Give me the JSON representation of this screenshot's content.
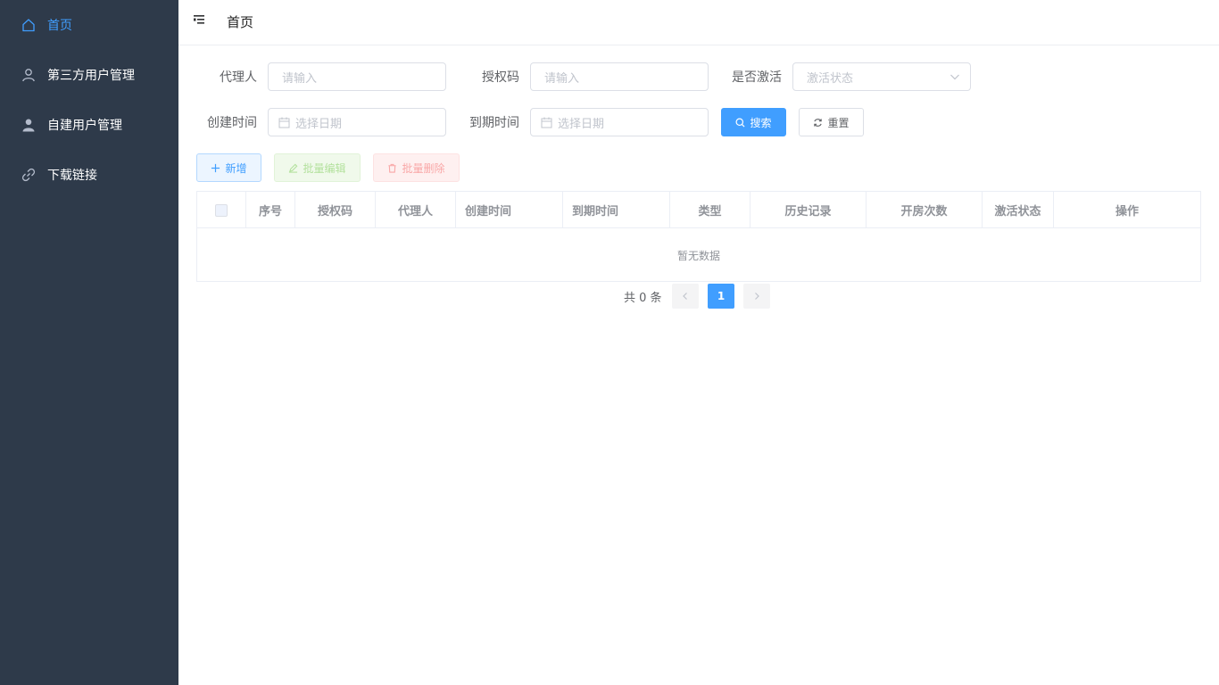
{
  "sidebar": {
    "items": [
      {
        "label": "首页",
        "icon": "home-icon",
        "active": true
      },
      {
        "label": "第三方用户管理",
        "icon": "user-outline-icon"
      },
      {
        "label": "自建用户管理",
        "icon": "user-solid-icon"
      },
      {
        "label": "下载链接",
        "icon": "link-icon"
      }
    ]
  },
  "header": {
    "breadcrumb": "首页",
    "menu_icon": "hamburger-icon"
  },
  "filters": {
    "agent": {
      "label": "代理人",
      "placeholder": "请输入",
      "value": ""
    },
    "auth_code": {
      "label": "授权码",
      "placeholder": "请输入",
      "value": ""
    },
    "activated": {
      "label": "是否激活",
      "placeholder": "激活状态",
      "value": ""
    },
    "created": {
      "label": "创建时间",
      "placeholder": "选择日期",
      "value": ""
    },
    "expire": {
      "label": "到期时间",
      "placeholder": "选择日期",
      "value": ""
    }
  },
  "actions": {
    "search": "搜索",
    "reset": "重置",
    "add": "新增",
    "batch_edit": "批量编辑",
    "batch_delete": "批量删除"
  },
  "table": {
    "columns": [
      "序号",
      "授权码",
      "代理人",
      "创建时间",
      "到期时间",
      "类型",
      "历史记录",
      "开房次数",
      "激活状态",
      "操作"
    ],
    "rows": [],
    "empty_text": "暂无数据"
  },
  "pagination": {
    "total_text": "共 0 条",
    "current_page": "1"
  },
  "colors": {
    "sidebar_bg": "#2e3a4a",
    "primary": "#409eff",
    "active_menu": "#409eff"
  }
}
